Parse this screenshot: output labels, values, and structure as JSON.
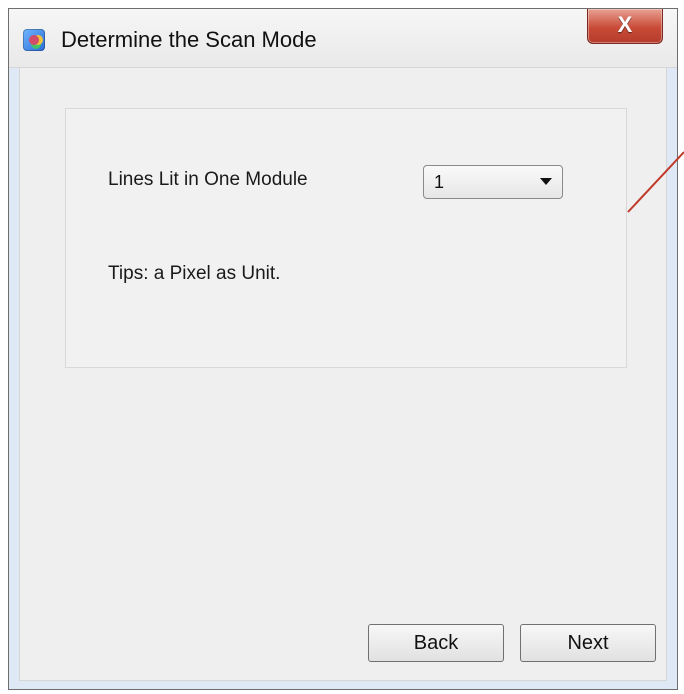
{
  "window": {
    "title": "Determine the Scan Mode",
    "close_glyph": "X"
  },
  "form": {
    "lines_label": "Lines Lit in One Module",
    "lines_value": "1",
    "tip_text": "Tips: a Pixel as Unit."
  },
  "buttons": {
    "back": "Back",
    "next": "Next"
  },
  "colors": {
    "accent": "#c94b38",
    "annotation_line": "#c03a2b"
  }
}
